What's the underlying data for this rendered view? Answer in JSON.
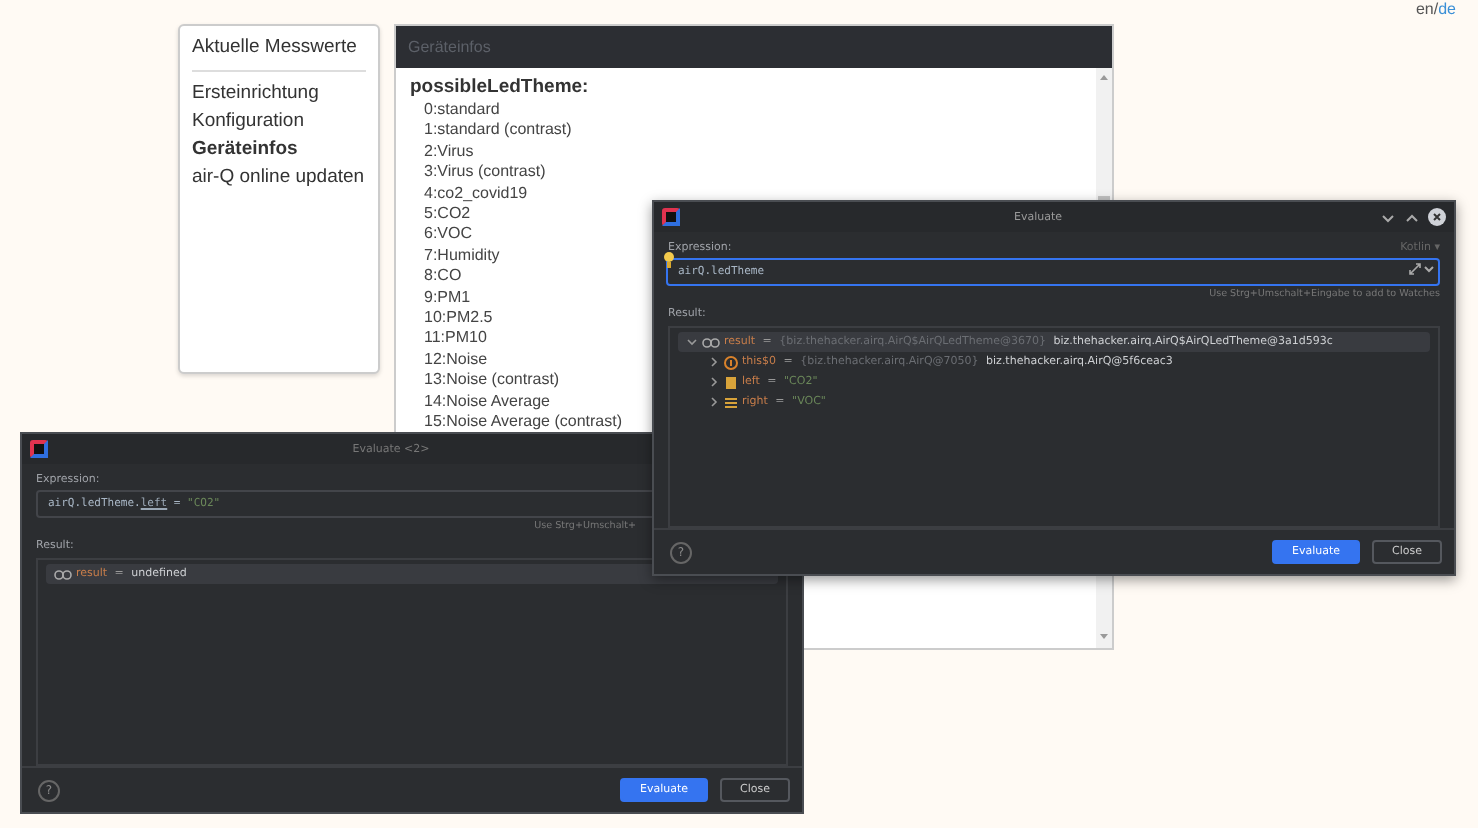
{
  "language_switch": {
    "separator": "/",
    "items": [
      {
        "label": "en",
        "selected": true
      },
      {
        "label": "de",
        "selected": false
      }
    ]
  },
  "sidebar": {
    "title": "Aktuelle Messwerte",
    "items": [
      {
        "label": "Ersteinrichtung",
        "selected": false
      },
      {
        "label": "Konfiguration",
        "selected": false
      },
      {
        "label": "Geräteinfos",
        "selected": true
      },
      {
        "label": "air-Q online updaten",
        "selected": false
      }
    ]
  },
  "panel": {
    "title": "Geräteinfos",
    "heading": "possibleLedTheme:",
    "items": [
      "0:standard",
      "1:standard (contrast)",
      "2:Virus",
      "3:Virus (contrast)",
      "4:co2_covid19",
      "5:CO2",
      "6:VOC",
      "7:Humidity",
      "8:CO",
      "9:PM1",
      "10:PM2.5",
      "11:PM10",
      "12:Noise",
      "13:Noise (contrast)",
      "14:Noise Average",
      "15:Noise Average (contrast)"
    ]
  },
  "dialogs": [
    {
      "title": "Evaluate <2>",
      "expression_label": "Expression:",
      "expression": [
        {
          "text": "airQ.ledTheme.",
          "kind": "code"
        },
        {
          "text": "left",
          "kind": "property"
        },
        {
          "text": " = ",
          "kind": "code"
        },
        {
          "text": "\"CO2\"",
          "kind": "string"
        }
      ],
      "focused": false,
      "hint": "Use Strg+Umschalt+",
      "result_label": "Result:",
      "tree": [
        {
          "kind": "watch",
          "name": "result",
          "sign": "=",
          "value": "undefined",
          "string": false,
          "selected": true
        }
      ],
      "help": "?",
      "buttons": [
        {
          "label": "Evaluate",
          "kind": "primary"
        },
        {
          "label": "Close",
          "kind": "secondary"
        }
      ]
    },
    {
      "title": "Evaluate",
      "expression_label": "Expression:",
      "language": "Kotlin ▾",
      "expression": [
        {
          "text": "airQ.ledTheme",
          "kind": "code"
        }
      ],
      "focused": true,
      "hint": "Use Strg+Umschalt+Eingabe to add to Watches",
      "result_label": "Result:",
      "tree": [
        {
          "kind": "watch",
          "name": "result",
          "sign": "=",
          "type": "{biz.thehacker.airq.AirQ$AirQLedTheme@3670}",
          "value": "biz.thehacker.airq.AirQ$AirQLedTheme@3a1d593c",
          "string": false,
          "selected": true,
          "expanded": true,
          "children": [
            {
              "kind": "object",
              "name": "this$0",
              "sign": "=",
              "type": "{biz.thehacker.airq.AirQ@7050}",
              "value": "biz.thehacker.airq.AirQ@5f6ceac3",
              "string": false,
              "selected": false,
              "expanded": false
            },
            {
              "kind": "field",
              "name": "left",
              "sign": "=",
              "value": "\"CO2\"",
              "string": true,
              "selected": false,
              "expanded": false
            },
            {
              "kind": "enum",
              "name": "right",
              "sign": "=",
              "value": "\"VOC\"",
              "string": true,
              "selected": false,
              "expanded": false
            }
          ]
        }
      ],
      "help": "?",
      "buttons": [
        {
          "label": "Evaluate",
          "kind": "primary"
        },
        {
          "label": "Close",
          "kind": "secondary"
        }
      ]
    }
  ]
}
